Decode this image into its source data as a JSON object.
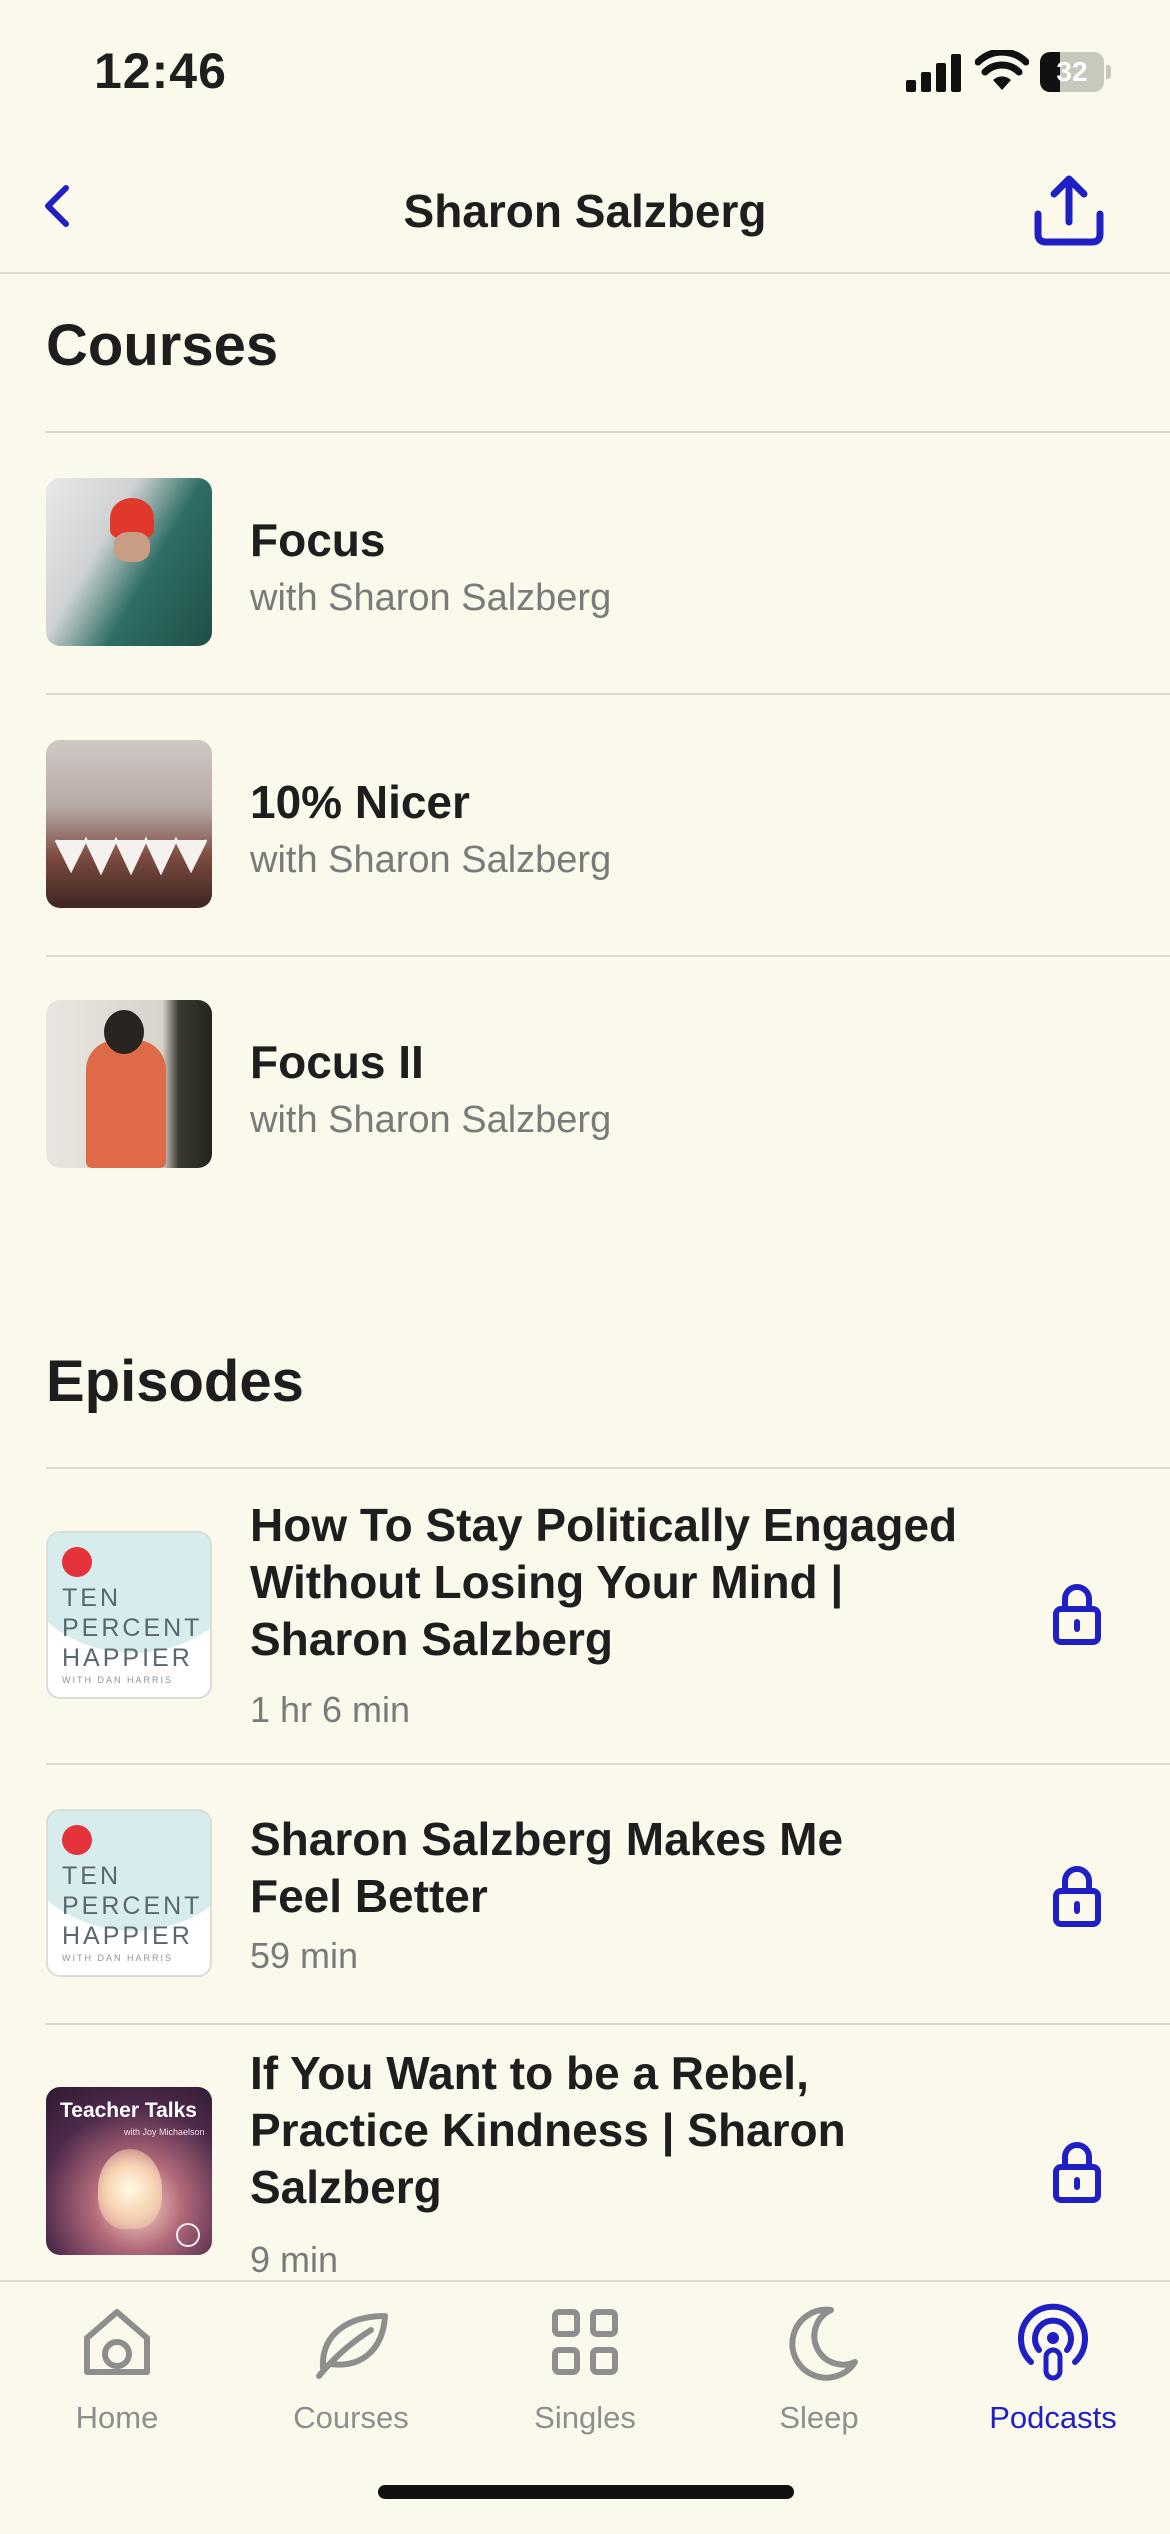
{
  "status_bar": {
    "time": "12:46",
    "battery": "32",
    "battery_level": 0.32
  },
  "header": {
    "title": "Sharon Salzberg",
    "back_icon": "chevron-left-icon",
    "share_icon": "share-icon"
  },
  "colors": {
    "accent": "#1f1fc4",
    "background": "#fbf9ec",
    "muted": "#7a7a7a",
    "tab_inactive": "#8e8e8e"
  },
  "courses": {
    "title": "Courses",
    "items": [
      {
        "title": "Focus",
        "subtitle": "with Sharon Salzberg"
      },
      {
        "title": "10% Nicer",
        "subtitle": "with Sharon Salzberg"
      },
      {
        "title": "Focus II",
        "subtitle": "with Sharon Salzberg"
      }
    ]
  },
  "episodes": {
    "title": "Episodes",
    "items": [
      {
        "title_lines": [
          "How To Stay Politically Engaged",
          "Without Losing Your Mind |",
          "Sharon Salzberg"
        ],
        "duration": "1 hr 6 min",
        "art": {
          "line1": "TEN",
          "line2": "PERCENT",
          "line3": "HAPPIER",
          "small": "WITH DAN HARRIS"
        },
        "locked_icon": "lock-icon"
      },
      {
        "title_lines": [
          "Sharon Salzberg Makes Me",
          "Feel Better"
        ],
        "duration": "59 min",
        "art": {
          "line1": "TEN",
          "line2": "PERCENT",
          "line3": "HAPPIER",
          "small": "WITH DAN HARRIS"
        },
        "locked_icon": "lock-icon"
      },
      {
        "title_lines": [
          "If You Want to be a Rebel,",
          "Practice Kindness | Sharon",
          "Salzberg"
        ],
        "duration": "9 min",
        "art": {
          "title": "Teacher Talks",
          "sub": "with Joy Michaelson"
        },
        "locked_icon": "lock-icon"
      }
    ]
  },
  "tabs": [
    {
      "label": "Home",
      "icon": "home-icon"
    },
    {
      "label": "Courses",
      "icon": "leaf-icon"
    },
    {
      "label": "Singles",
      "icon": "grid-icon"
    },
    {
      "label": "Sleep",
      "icon": "moon-icon"
    },
    {
      "label": "Podcasts",
      "icon": "podcast-icon",
      "active": true
    }
  ]
}
